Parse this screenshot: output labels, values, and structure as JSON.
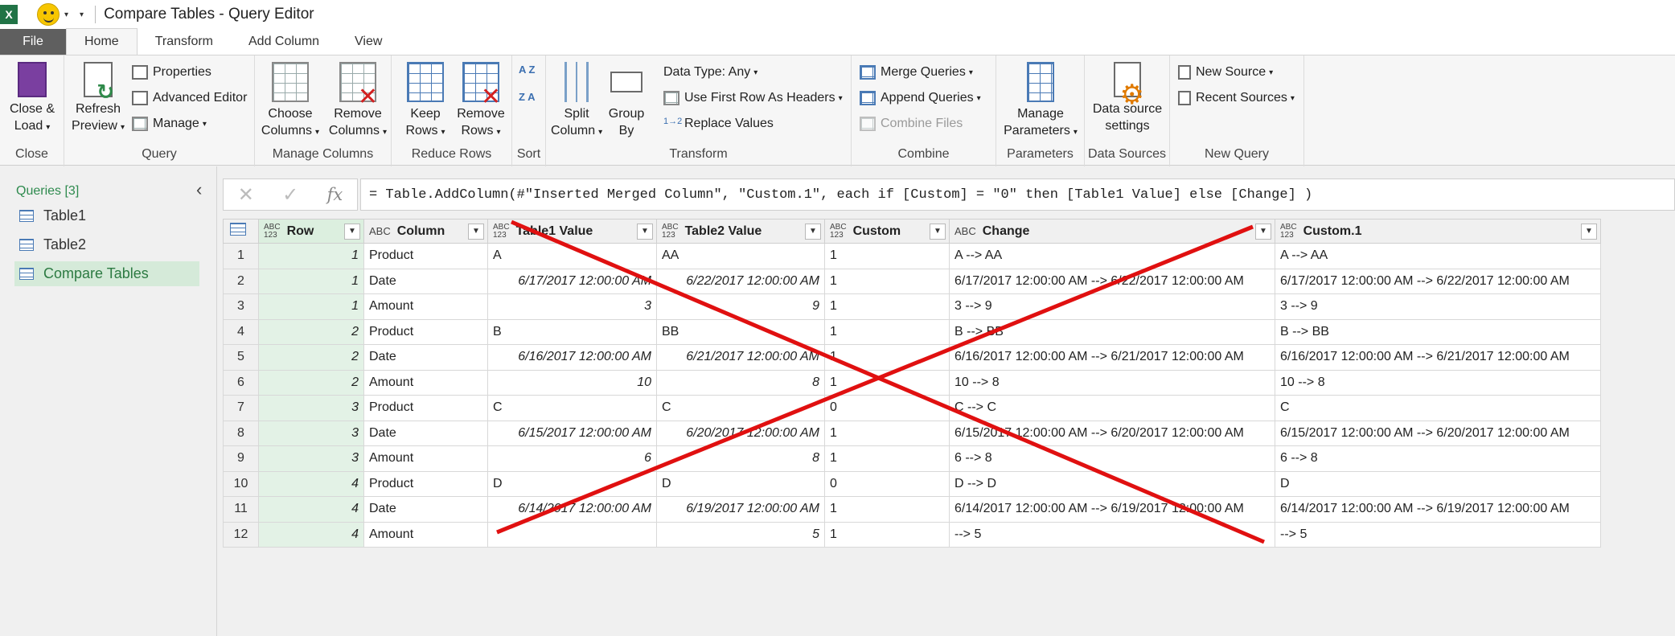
{
  "titlebar": {
    "app_icon": "X",
    "title": "Compare Tables - Query Editor"
  },
  "tabs": [
    "File",
    "Home",
    "Transform",
    "Add Column",
    "View"
  ],
  "ribbon": {
    "close": {
      "label": "Close",
      "close_load": "Close &",
      "close_load2": "Load"
    },
    "query": {
      "label": "Query",
      "refresh": "Refresh",
      "refresh2": "Preview",
      "properties": "Properties",
      "advanced": "Advanced Editor",
      "manage": "Manage"
    },
    "manage_columns": {
      "label": "Manage Columns",
      "choose": "Choose",
      "choose2": "Columns",
      "remove": "Remove",
      "remove2": "Columns"
    },
    "reduce_rows": {
      "label": "Reduce Rows",
      "keep": "Keep",
      "keep2": "Rows",
      "remove": "Remove",
      "remove2": "Rows"
    },
    "sort": {
      "label": "Sort",
      "az": "A Z",
      "za": "Z A"
    },
    "transform": {
      "label": "Transform",
      "split": "Split",
      "split2": "Column",
      "group": "Group",
      "group2": "By",
      "datatype": "Data Type: Any",
      "firstrow": "Use First Row As Headers",
      "replace": "Replace Values",
      "replace_glyph": "1→2"
    },
    "combine": {
      "label": "Combine",
      "merge": "Merge Queries",
      "append": "Append Queries",
      "files": "Combine Files"
    },
    "parameters": {
      "label": "Parameters",
      "manage": "Manage",
      "manage2": "Parameters"
    },
    "data_sources": {
      "label": "Data Sources",
      "settings": "Data source",
      "settings2": "settings"
    },
    "new_query": {
      "label": "New Query",
      "new_source": "New Source",
      "recent": "Recent Sources"
    }
  },
  "queries": {
    "header": "Queries [3]",
    "items": [
      "Table1",
      "Table2",
      "Compare Tables"
    ]
  },
  "formula": {
    "cancel": "✕",
    "commit": "✓",
    "fx": "fx",
    "text": "= Table.AddColumn(#\"Inserted Merged Column\", \"Custom.1\", each if [Custom] = \"0\" then [Table1 Value] else [Change] )"
  },
  "grid": {
    "columns": [
      {
        "name": "Row",
        "type": "ABC/123"
      },
      {
        "name": "Column",
        "type": "ABC"
      },
      {
        "name": "Table1 Value",
        "type": "ABC/123"
      },
      {
        "name": "Table2 Value",
        "type": "ABC/123"
      },
      {
        "name": "Custom",
        "type": "ABC/123"
      },
      {
        "name": "Change",
        "type": "ABC"
      },
      {
        "name": "Custom.1",
        "type": "ABC/123"
      }
    ],
    "rows": [
      [
        "1",
        "1",
        "Product",
        "A",
        "AA",
        "1",
        "A --> AA",
        "A --> AA"
      ],
      [
        "2",
        "1",
        "Date",
        "6/17/2017 12:00:00 AM",
        "6/22/2017 12:00:00 AM",
        "1",
        "6/17/2017 12:00:00 AM --> 6/22/2017 12:00:00 AM",
        "6/17/2017 12:00:00 AM --> 6/22/2017 12:00:00 AM"
      ],
      [
        "3",
        "1",
        "Amount",
        "3",
        "9",
        "1",
        "3 --> 9",
        "3 --> 9"
      ],
      [
        "4",
        "2",
        "Product",
        "B",
        "BB",
        "1",
        "B --> BB",
        "B --> BB"
      ],
      [
        "5",
        "2",
        "Date",
        "6/16/2017 12:00:00 AM",
        "6/21/2017 12:00:00 AM",
        "1",
        "6/16/2017 12:00:00 AM --> 6/21/2017 12:00:00 AM",
        "6/16/2017 12:00:00 AM --> 6/21/2017 12:00:00 AM"
      ],
      [
        "6",
        "2",
        "Amount",
        "10",
        "8",
        "1",
        "10 --> 8",
        "10 --> 8"
      ],
      [
        "7",
        "3",
        "Product",
        "C",
        "C",
        "0",
        "C --> C",
        "C"
      ],
      [
        "8",
        "3",
        "Date",
        "6/15/2017 12:00:00 AM",
        "6/20/2017 12:00:00 AM",
        "1",
        "6/15/2017 12:00:00 AM --> 6/20/2017 12:00:00 AM",
        "6/15/2017 12:00:00 AM --> 6/20/2017 12:00:00 AM"
      ],
      [
        "9",
        "3",
        "Amount",
        "6",
        "8",
        "1",
        "6 --> 8",
        "6 --> 8"
      ],
      [
        "10",
        "4",
        "Product",
        "D",
        "D",
        "0",
        "D --> D",
        "D"
      ],
      [
        "11",
        "4",
        "Date",
        "6/14/2017 12:00:00 AM",
        "6/19/2017 12:00:00 AM",
        "1",
        "6/14/2017 12:00:00 AM --> 6/19/2017 12:00:00 AM",
        "6/14/2017 12:00:00 AM --> 6/19/2017 12:00:00 AM"
      ],
      [
        "12",
        "4",
        "Amount",
        "",
        "5",
        "1",
        " --> 5",
        " --> 5"
      ]
    ]
  },
  "overlay": {
    "color": "#e01010"
  },
  "colors": {
    "excel_green": "#217346",
    "query_green": "#2e8a4e",
    "file_tab": "#5f5f5f"
  }
}
